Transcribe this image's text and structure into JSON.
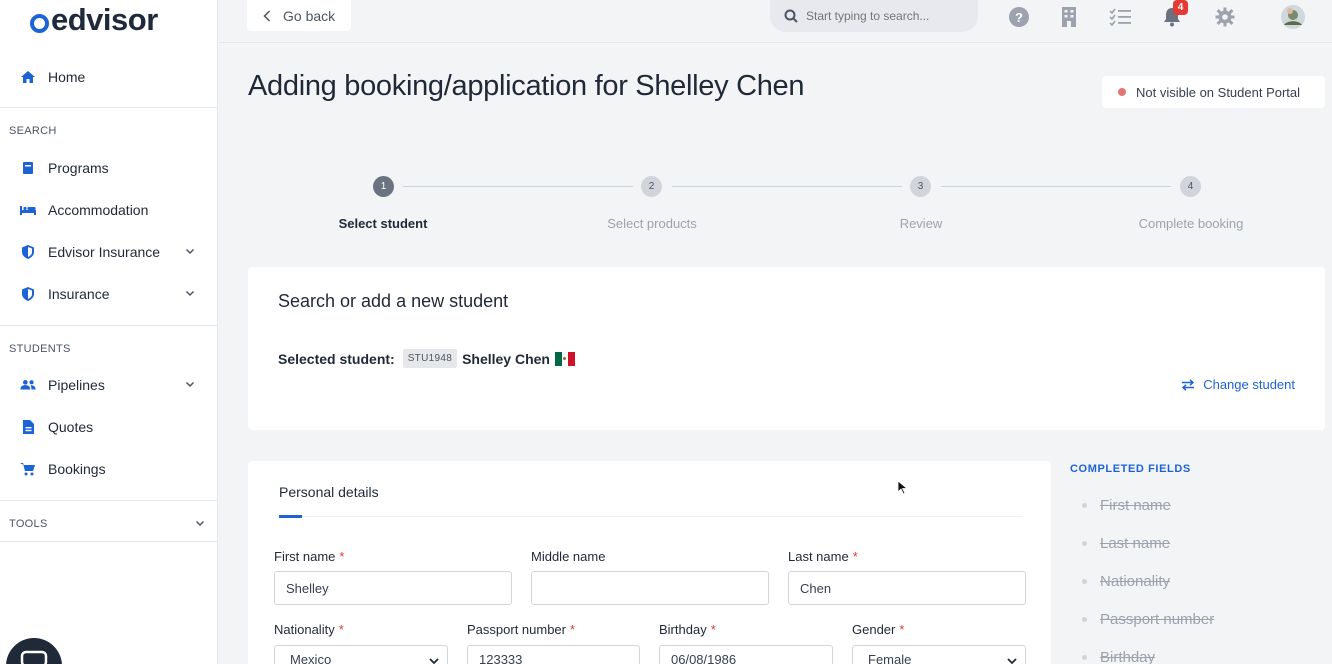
{
  "app": {
    "logo_text": "edvisor",
    "brand_color": "#1e63d6"
  },
  "sidebar": {
    "home": "Home",
    "sections": {
      "search": "SEARCH",
      "students": "STUDENTS",
      "tools": "TOOLS"
    },
    "items": [
      {
        "label": "Programs",
        "icon": "book-icon"
      },
      {
        "label": "Accommodation",
        "icon": "bed-icon"
      },
      {
        "label": "Edvisor Insurance",
        "icon": "shield-icon"
      },
      {
        "label": "Insurance",
        "icon": "shield-icon"
      },
      {
        "label": "Pipelines",
        "icon": "users-icon"
      },
      {
        "label": "Quotes",
        "icon": "document-icon"
      },
      {
        "label": "Bookings",
        "icon": "cart-icon"
      }
    ]
  },
  "topbar": {
    "go_back": "Go back",
    "search_placeholder": "Start typing to search...",
    "notifications_count": "4"
  },
  "page": {
    "title": "Adding booking/application for Shelley Chen",
    "visibility": "Not visible on Student Portal"
  },
  "stepper": {
    "steps": [
      {
        "num": "1",
        "label": "Select student",
        "active": true
      },
      {
        "num": "2",
        "label": "Select products",
        "active": false
      },
      {
        "num": "3",
        "label": "Review",
        "active": false
      },
      {
        "num": "4",
        "label": "Complete booking",
        "active": false
      }
    ]
  },
  "student_card": {
    "heading": "Search or add a new student",
    "selected_label": "Selected student:",
    "student_id": "STU1948",
    "student_name": "Shelley Chen",
    "change_label": "Change student"
  },
  "personal": {
    "heading": "Personal details",
    "fields": {
      "first_name": {
        "label": "First name",
        "value": "Shelley",
        "required": true
      },
      "middle_name": {
        "label": "Middle name",
        "value": "",
        "required": false
      },
      "last_name": {
        "label": "Last name",
        "value": "Chen",
        "required": true
      },
      "nationality": {
        "label": "Nationality",
        "value": "Mexico",
        "required": true
      },
      "passport": {
        "label": "Passport number",
        "value": "123333",
        "required": true
      },
      "birthday": {
        "label": "Birthday",
        "value": "06/08/1986",
        "required": true
      },
      "gender": {
        "label": "Gender",
        "value": "Female",
        "required": true
      }
    },
    "required_mark": "*"
  },
  "completed": {
    "title": "COMPLETED FIELDS",
    "items": [
      "First name",
      "Last name",
      "Nationality",
      "Passport number",
      "Birthday"
    ]
  }
}
